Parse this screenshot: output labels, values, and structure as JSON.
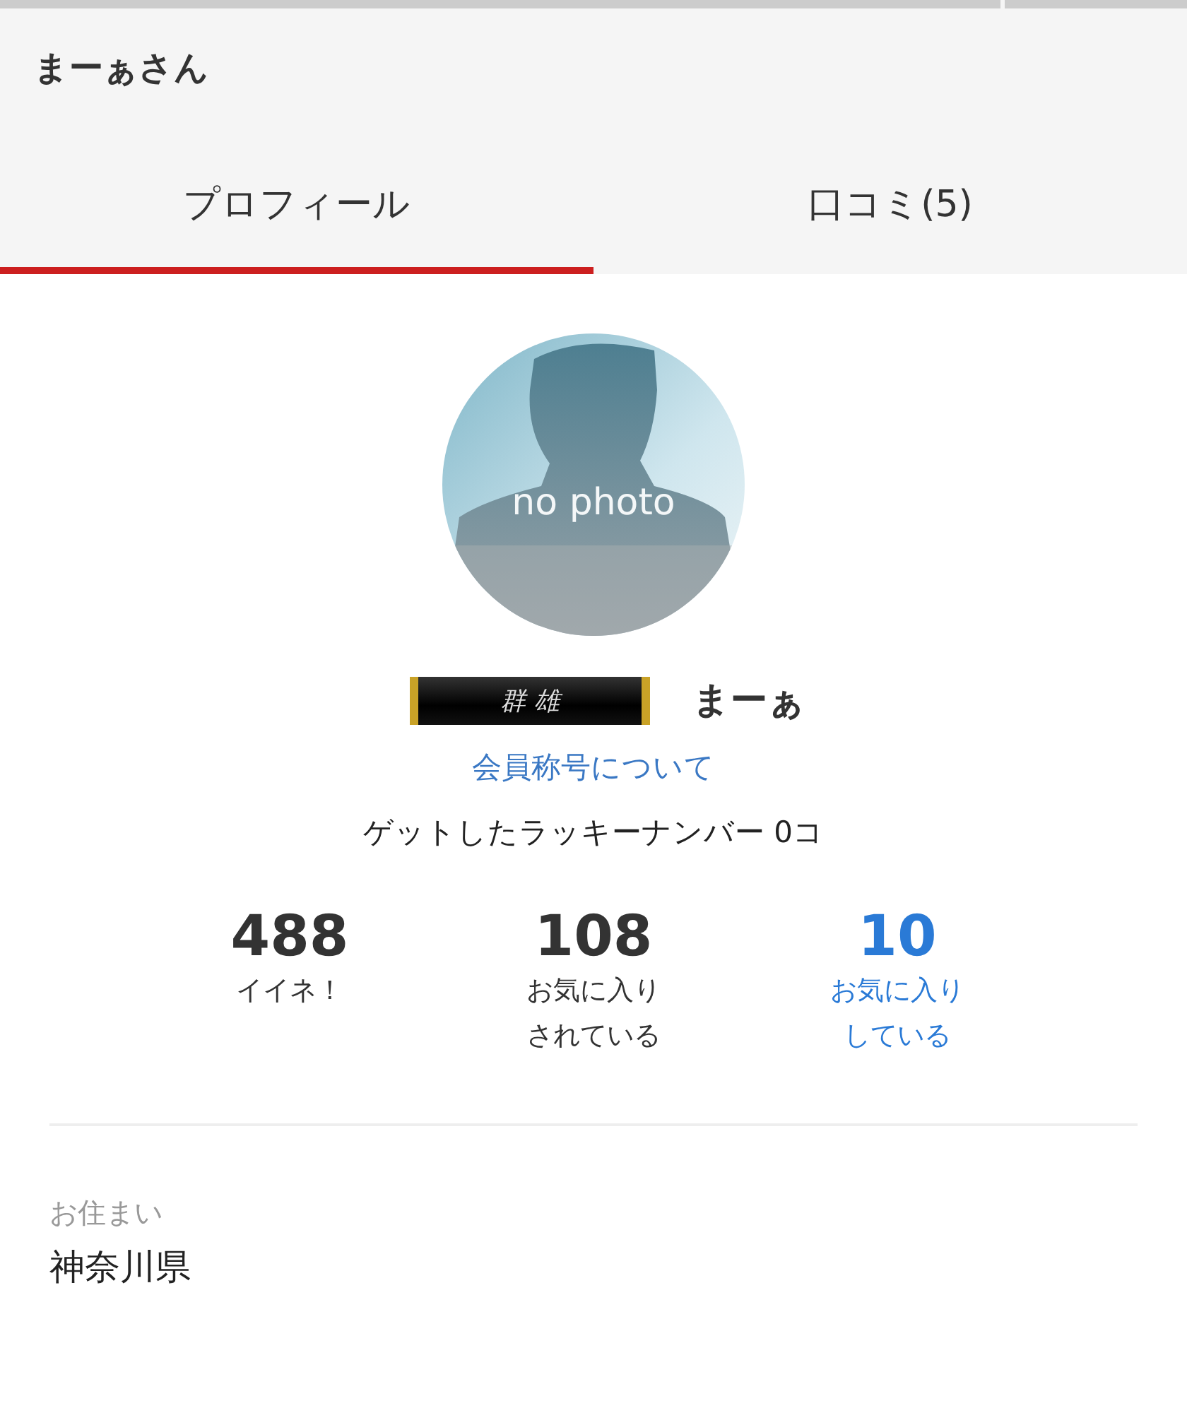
{
  "header": {
    "title": "まーぁさん"
  },
  "tabs": [
    {
      "label": "プロフィール",
      "selected": true
    },
    {
      "label": "口コミ(5)",
      "selected": false
    }
  ],
  "profile": {
    "avatar": {
      "kind": "picture",
      "caption": "no photo"
    },
    "rank_badge": "群 雄",
    "name": "まーぁ",
    "rank_link": "会員称号について",
    "lucky_numbers": "ゲットしたラッキーナンバー 0コ"
  },
  "stats": [
    {
      "value": "488",
      "label": "イイネ！",
      "kind": "plain"
    },
    {
      "value": "108",
      "label": "お気に入りされている",
      "kind": "plain"
    },
    {
      "value": "10",
      "label": "お気に入りしている",
      "kind": "link"
    }
  ],
  "details": [
    {
      "label": "お住まい",
      "value": "神奈川県"
    }
  ]
}
